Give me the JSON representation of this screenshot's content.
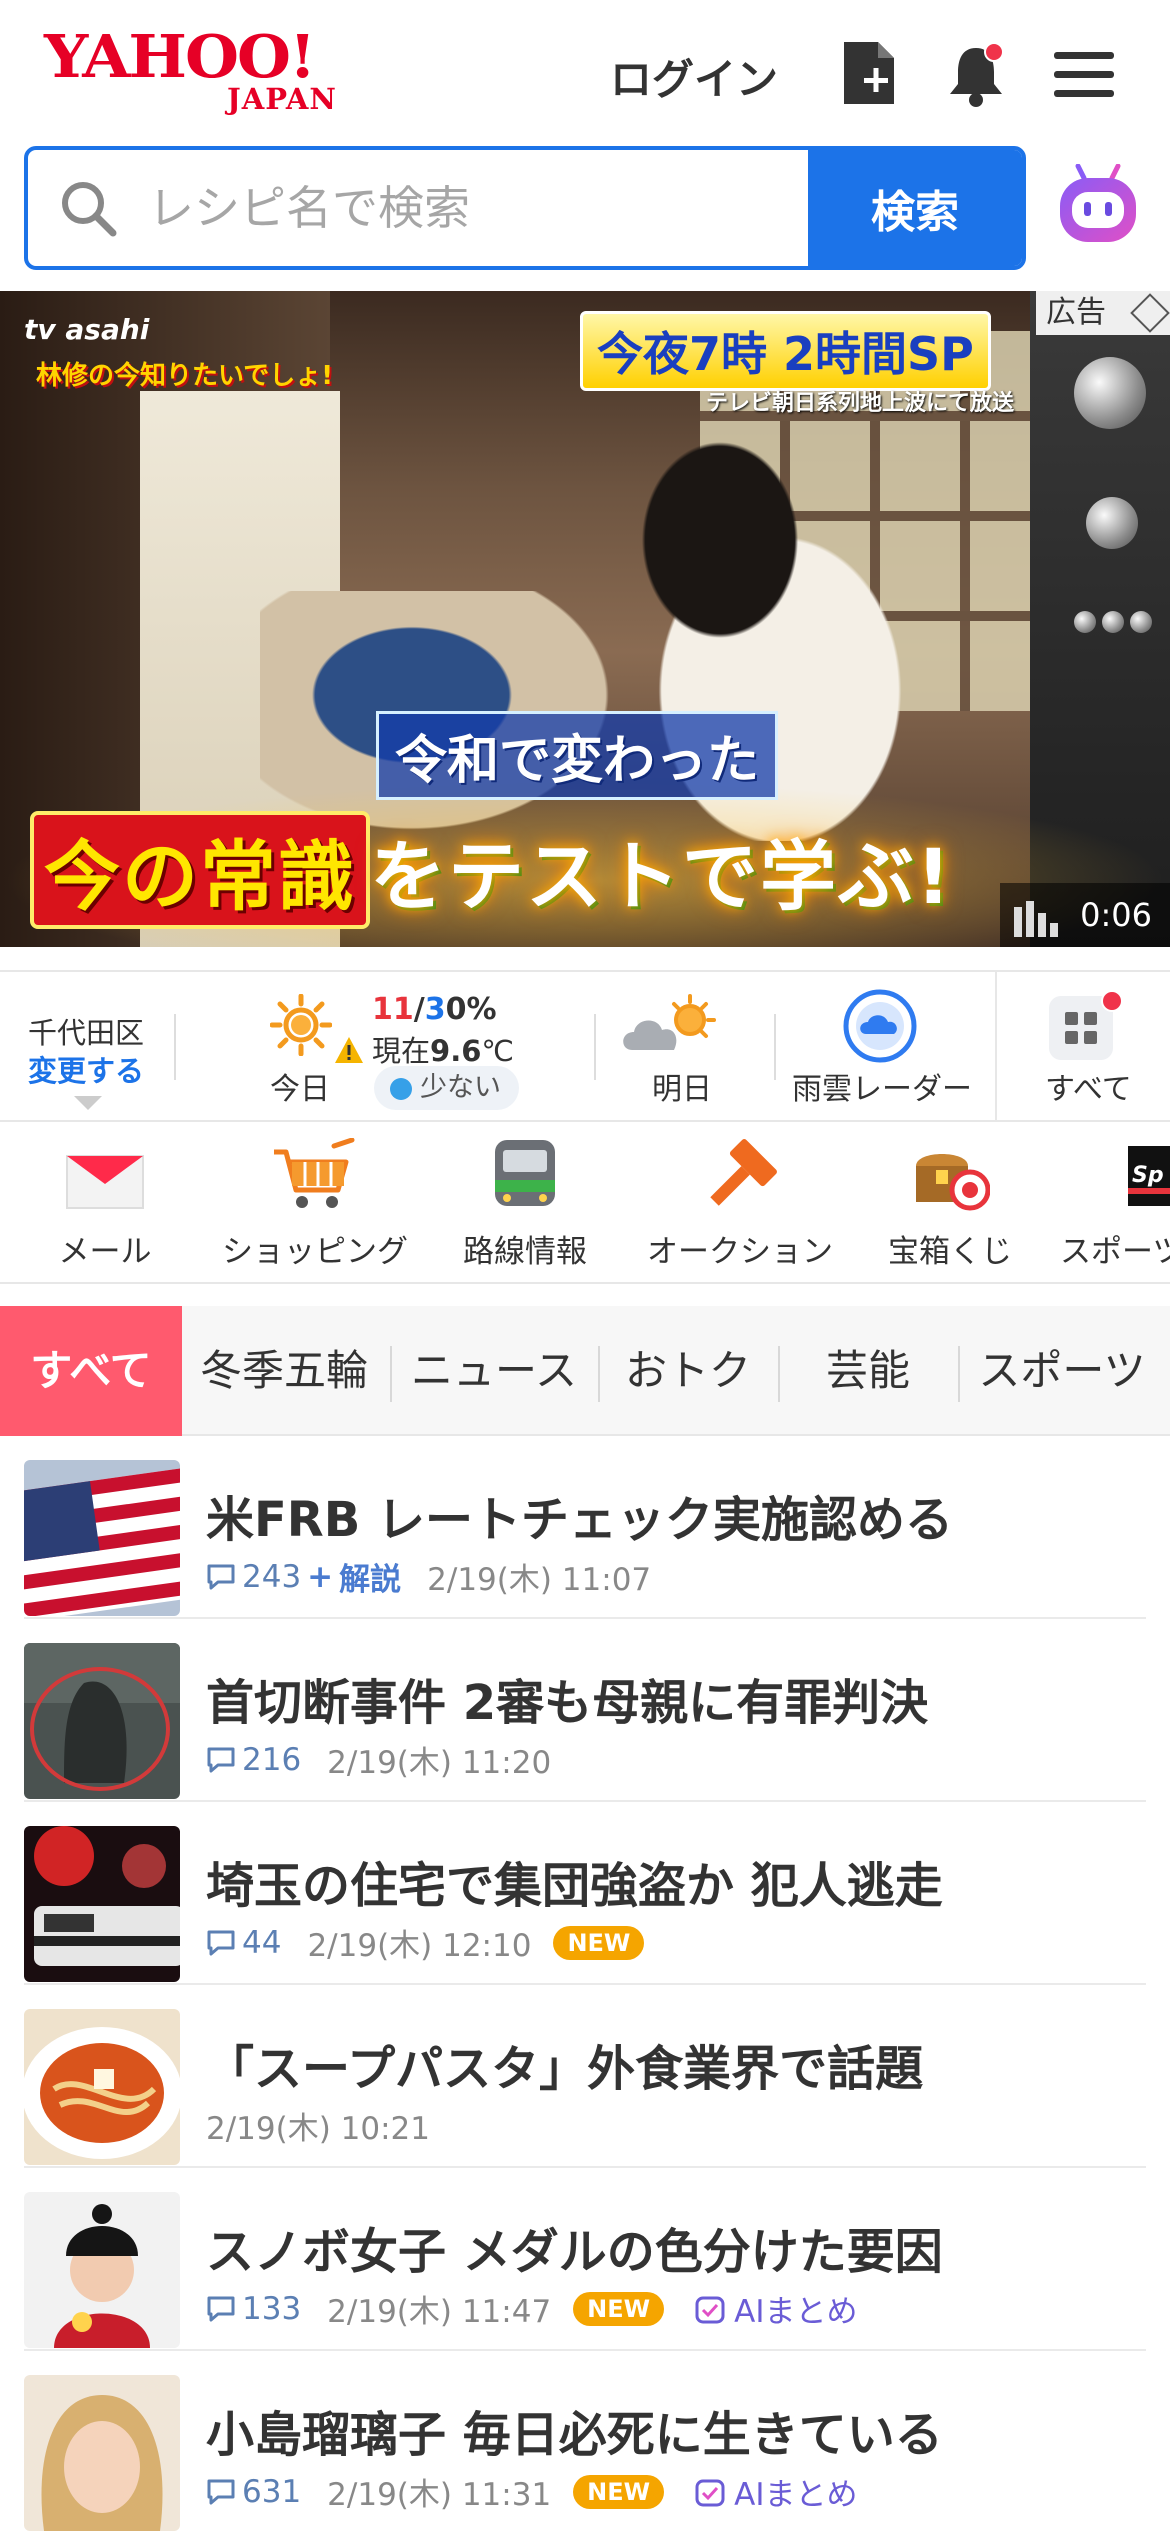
{
  "header": {
    "logo_main": "YAHOO!",
    "logo_sub": "JAPAN",
    "login": "ログイン"
  },
  "search": {
    "placeholder": "レシピ名で検索",
    "button": "検索"
  },
  "ad": {
    "badge": "広告",
    "tv_logo": "tv asahi",
    "show_logo": "林修の今知りたいでしょ!",
    "tonight": "今夜7時 2時間SP",
    "tonight_sub": "テレビ朝日系列地上波にて放送",
    "caption_top": "令和で変わった",
    "caption_main_red": "今の常識",
    "caption_main_rest": "をテストで学ぶ!",
    "timer": "0:06"
  },
  "weather": {
    "location": "千代田区",
    "change": "変更する",
    "today_label": "今日",
    "hi": "11",
    "slash": "/",
    "lo": "3",
    "precip": "0%",
    "now_prefix": "現在",
    "now_temp": "9.6",
    "now_unit": "℃",
    "pollen": "少ない",
    "tomorrow_label": "明日",
    "radar_label": "雨雲レーダー",
    "all_label": "すべて"
  },
  "services": [
    {
      "label": "メール",
      "icon": "mail-icon"
    },
    {
      "label": "ショッピング",
      "icon": "cart-icon"
    },
    {
      "label": "路線情報",
      "icon": "train-icon"
    },
    {
      "label": "オークション",
      "icon": "auction-hammer-icon"
    },
    {
      "label": "宝箱くじ",
      "icon": "treasure-box-icon"
    },
    {
      "label": "スポーツ",
      "icon": "sports-icon"
    }
  ],
  "tabs": [
    "すべて",
    "冬季五輪",
    "ニュース",
    "おトク",
    "芸能",
    "スポーツ"
  ],
  "news": [
    {
      "title": "米FRB レートチェック実施認める",
      "comments": "243",
      "plus": "+",
      "explain": "解説",
      "time": "2/19(木) 11:07"
    },
    {
      "title": "首切断事件 2審も母親に有罪判決",
      "comments": "216",
      "time": "2/19(木) 11:20"
    },
    {
      "title": "埼玉の住宅で集団強盗か 犯人逃走",
      "comments": "44",
      "time": "2/19(木) 12:10",
      "new": "NEW"
    },
    {
      "title": "「スープパスタ」外食業界で話題",
      "time": "2/19(木) 10:21"
    },
    {
      "title": "スノボ女子 メダルの色分けた要因",
      "comments": "133",
      "time": "2/19(木) 11:47",
      "new": "NEW",
      "ai": "AIまとめ"
    },
    {
      "title": "小島瑠璃子 毎日必死に生きている",
      "comments": "631",
      "time": "2/19(木) 11:31",
      "new": "NEW",
      "ai": "AIまとめ"
    }
  ],
  "colors": {
    "brand_red": "#e60026",
    "search_blue": "#1c73e8",
    "tab_active": "#ff5a6e",
    "new_badge": "#f5a500"
  }
}
